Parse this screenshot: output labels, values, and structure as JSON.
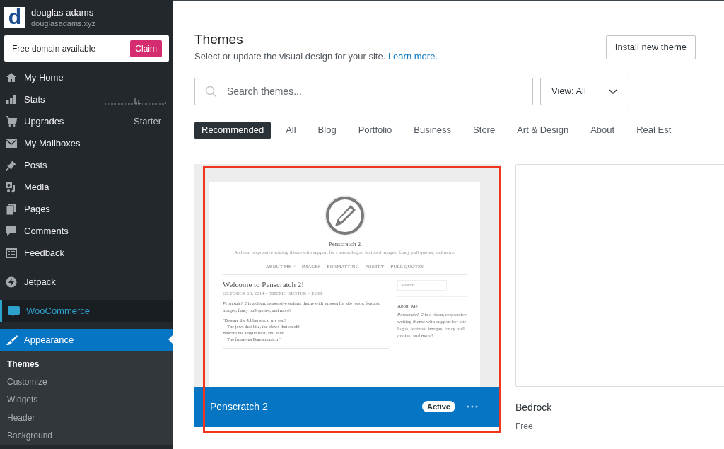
{
  "site": {
    "name": "douglas adams",
    "url": "douglasadams.xyz",
    "logo_letter": "d"
  },
  "domain_banner": {
    "text": "Free domain available",
    "button": "Claim"
  },
  "sidebar": {
    "sections": [
      [
        {
          "label": "My Home",
          "selected": false
        },
        {
          "label": "Stats",
          "selected": false,
          "kind": "stats"
        },
        {
          "label": "Upgrades",
          "selected": false,
          "badge": "Starter"
        },
        {
          "label": "My Mailboxes",
          "selected": false
        },
        {
          "label": "Posts",
          "selected": false
        },
        {
          "label": "Media",
          "selected": false
        },
        {
          "label": "Pages",
          "selected": false
        },
        {
          "label": "Comments",
          "selected": false
        },
        {
          "label": "Feedback",
          "selected": false
        }
      ],
      [
        {
          "label": "Jetpack",
          "selected": false
        }
      ],
      [
        {
          "label": "WooCommerce",
          "selected": false,
          "kind": "plugin"
        }
      ],
      [
        {
          "label": "Appearance",
          "selected": true,
          "children": [
            {
              "label": "Themes",
              "selected": true
            },
            {
              "label": "Customize",
              "selected": false
            },
            {
              "label": "Widgets",
              "selected": false
            },
            {
              "label": "Header",
              "selected": false
            },
            {
              "label": "Background",
              "selected": false
            }
          ]
        }
      ]
    ]
  },
  "header": {
    "title": "Themes",
    "subtitle": "Select or update the visual design for your site.",
    "link": "Learn more.",
    "button": "Install new theme"
  },
  "search": {
    "placeholder": "Search themes..."
  },
  "view_select": {
    "value": "View: All"
  },
  "filters": [
    {
      "label": "Recommended",
      "selected": true
    },
    {
      "label": "All",
      "selected": false
    },
    {
      "label": "Blog",
      "selected": false
    },
    {
      "label": "Portfolio",
      "selected": false
    },
    {
      "label": "Business",
      "selected": false
    },
    {
      "label": "Store",
      "selected": false
    },
    {
      "label": "Art & Design",
      "selected": false
    },
    {
      "label": "About",
      "selected": false
    },
    {
      "label": "Real Est",
      "selected": false
    }
  ],
  "themes": [
    {
      "name": "Penscratch 2",
      "active": true,
      "badge": "Active",
      "annotated": true,
      "preview": {
        "site_title": "Penscratch 2",
        "tagline": "A clean, responsive writing theme with support for custom logos, featured images, fancy pull quotes, and more.",
        "nav": [
          "ABOUT ME ˅",
          "IMAGES",
          "FORMATTING",
          "POETRY",
          "PULL QUOTES"
        ],
        "post_title": "Welcome to Penscratch 2!",
        "post_meta": "OCTOBER 13, 2014 – THEME BUSTER – EDIT",
        "post_body": "*Penscratch 2* is a clean, responsive writing theme with support for site logos, featured images, fancy pull quotes, and more!",
        "poem": [
          {
            "text": "\"Beware the Jabberwock, my son!",
            "indented": false
          },
          {
            "text": "The jaws that bite, the claws that catch!",
            "indented": true
          },
          {
            "text": "Beware the Jubjub bird, and shun",
            "indented": false
          },
          {
            "text": "The frumious Bandersnatch!\"",
            "indented": true
          }
        ],
        "search_placeholder": "Search …",
        "widget_title": "About Me",
        "widget_text": "*Penscratch 2* is a clean, responsive writing theme with support for site logos, featured images, fancy pull quotes, and more!"
      }
    },
    {
      "name": "Bedrock",
      "active": false,
      "price": "Free",
      "annotated": false
    }
  ]
}
